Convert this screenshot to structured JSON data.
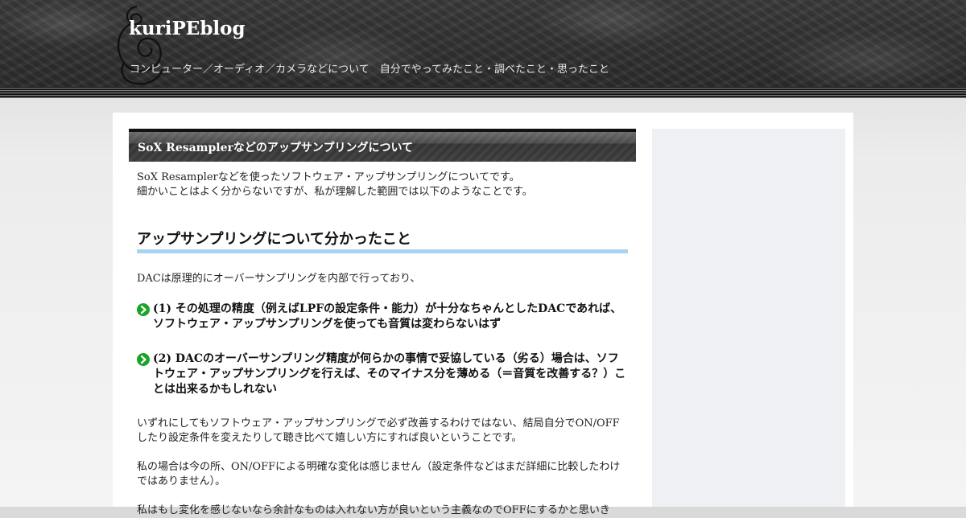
{
  "header": {
    "site_title": "kuriPEblog",
    "tagline": "コンピューター／オーディオ／カメラなどについて　自分でやってみたこと・調べたこと・思ったこと",
    "logo_icon": "swirl-logo-icon"
  },
  "post": {
    "title": "SoX Resamplerなどのアップサンプリングについて",
    "intro": [
      "SoX Resamplerなどを使ったソフトウェア・アップサンプリングについてです。",
      "細かいことはよく分からないですが、私が理解した範囲では以下のようなことです。"
    ],
    "heading": "アップサンプリングについて分かったこと",
    "lead": "DACは原理的にオーバーサンプリングを内部で行っており、",
    "points": [
      "(1) その処理の精度（例えばLPFの設定条件・能力）が十分なちゃんとしたDACであれば、ソフトウェア・アップサンプリングを使っても音質は変わらないはず",
      "(2) DACのオーバーサンプリング精度が何らかの事情で妥協している（劣る）場合は、ソフトウェア・アップサンプリングを行えば、そのマイナス分を薄める（＝音質を改善する？）ことは出来るかもしれない"
    ],
    "paragraphs": [
      "いずれにしてもソフトウェア・アップサンプリングで必ず改善するわけではない、結局自分でON/OFFしたり設定条件を変えたりして聴き比べて嬉しい方にすれば良いということです。",
      "私の場合は今の所、ON/OFFによる明確な変化は感じません（設定条件などはまだ詳細に比較したわけではありません）。",
      "私はもし変化を感じないなら余計なものは入れない方が良いという主義なのでOFFにするかと思いき"
    ],
    "bullet_icon": "green-arrow-circle-icon",
    "colors": {
      "heading_underline": "#a8d4f0",
      "bullet": "#1aa52a",
      "sidebar_bg": "#eff0f4"
    }
  }
}
